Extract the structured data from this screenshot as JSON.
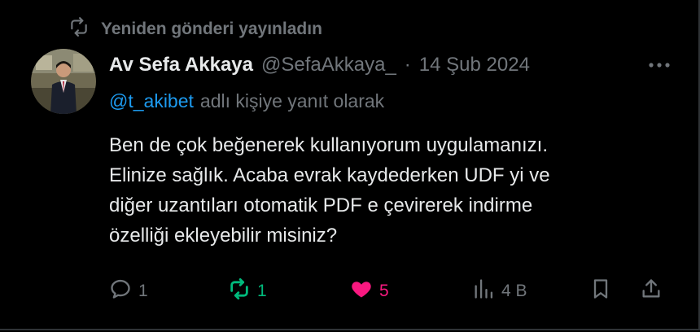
{
  "repost": {
    "label": "Yeniden gönderi yayınladın",
    "icon": "repost-icon"
  },
  "tweet": {
    "author_name": "Av Sefa Akkaya",
    "author_handle": "@SefaAkkaya_",
    "separator": "·",
    "date": "14 Şub 2024",
    "more_icon": "more-icon",
    "reply_to_handle": "@t_akibet",
    "reply_to_suffix": "adlı kişiye yanıt olarak",
    "body_lines": [
      "Ben de çok beğenerek kullanıyorum uygulamanızı.",
      "Elinize sağlık. Acaba evrak kaydederken UDF yi ve",
      "diğer uzantıları otomatik PDF e çevirerek indirme",
      "özelliği ekleyebilir misiniz?"
    ]
  },
  "actions": {
    "reply_count": "1",
    "repost_count": "1",
    "like_count": "5",
    "views_count": "4 B"
  },
  "colors": {
    "background": "#000000",
    "text_primary": "#e7e9ea",
    "text_secondary": "#71767b",
    "link": "#1d9bf0",
    "repost_active": "#00ba7c",
    "like_active": "#f91880"
  }
}
